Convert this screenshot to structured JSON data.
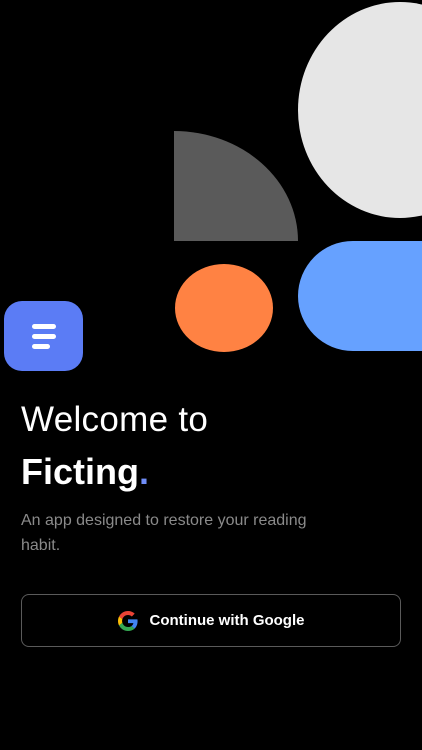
{
  "welcome": {
    "line1": "Welcome to",
    "brand": "Ficting",
    "brand_dot": "."
  },
  "tagline": "An app designed to restore your reading habit.",
  "google_button": {
    "label": "Continue with Google",
    "icon": "google-icon"
  },
  "colors": {
    "background": "#000000",
    "accent": "#6f8df7",
    "logo_bg": "#5b7cf5",
    "shape_light": "#e6e6e6",
    "shape_gray": "#5a5a5a",
    "shape_orange": "#ff8243",
    "shape_blue": "#66a1ff",
    "muted_text": "#8a8a8a"
  },
  "icons": {
    "battery": "battery-icon",
    "app_logo": "book-menu-icon"
  }
}
